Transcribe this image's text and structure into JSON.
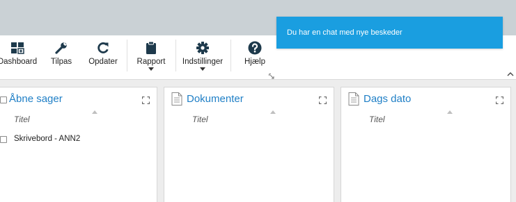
{
  "notification": {
    "text": "Du har en chat med nye beskeder"
  },
  "ribbon": {
    "dashboard_label": "Dashboard",
    "tilpas_label": "Tilpas",
    "opdater_label": "Opdater",
    "rapport_label": "Rapport",
    "indstillinger_label": "Indstillinger",
    "hjaelp_label": "Hjælp"
  },
  "panels": [
    {
      "title": "Åbne sager",
      "column": "Titel",
      "rows": [
        "Skrivebord - ANN2"
      ]
    },
    {
      "title": "Dokumenter",
      "column": "Titel",
      "rows": []
    },
    {
      "title": "Dags dato",
      "column": "Titel",
      "rows": []
    }
  ],
  "colors": {
    "accent": "#1a9ee0",
    "panel_title": "#1f7fc6",
    "icon": "#1e3a4c",
    "topbar": "#cad1d5"
  }
}
